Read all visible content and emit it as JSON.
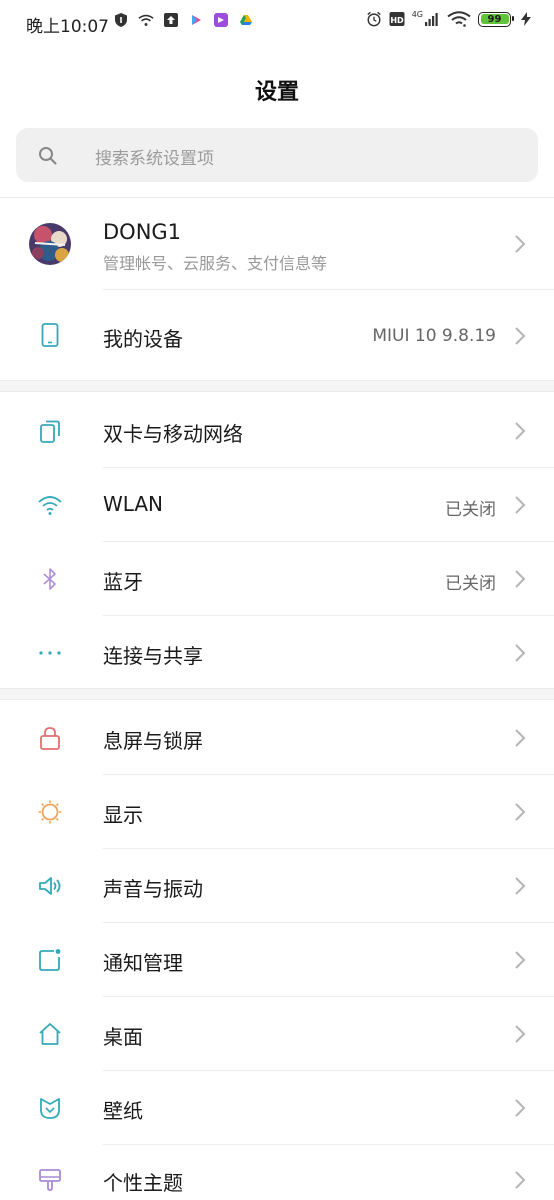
{
  "status_bar": {
    "time": "晚上10:07",
    "network": "4G",
    "battery": "99",
    "battery_color": "#62c23a"
  },
  "title": "设置",
  "search": {
    "placeholder": "搜索系统设置项"
  },
  "account": {
    "name": "DONG1",
    "subtitle": "管理帐号、云服务、支付信息等"
  },
  "device": {
    "label": "我的设备",
    "value": "MIUI 10 9.8.19"
  },
  "group2": [
    {
      "label": "双卡与移动网络",
      "value": "",
      "icon": "sim-card-icon"
    },
    {
      "label": "WLAN",
      "value": "已关闭",
      "icon": "wifi-icon"
    },
    {
      "label": "蓝牙",
      "value": "已关闭",
      "icon": "bluetooth-icon"
    },
    {
      "label": "连接与共享",
      "value": "",
      "icon": "more-dots-icon"
    }
  ],
  "group3": [
    {
      "label": "息屏与锁屏",
      "icon": "lock-icon"
    },
    {
      "label": "显示",
      "icon": "sun-icon"
    },
    {
      "label": "声音与振动",
      "icon": "speaker-icon"
    },
    {
      "label": "通知管理",
      "icon": "notification-icon"
    },
    {
      "label": "桌面",
      "icon": "home-icon"
    },
    {
      "label": "壁纸",
      "icon": "wallpaper-icon"
    },
    {
      "label": "个性主题",
      "icon": "theme-brush-icon"
    }
  ],
  "colors": {
    "accent_teal": "#34a9b8",
    "lock_red": "#e0706f",
    "sun_orange": "#f0a35a",
    "bluetooth_purple": "#b08fd8",
    "theme_purple": "#a98bd6"
  }
}
